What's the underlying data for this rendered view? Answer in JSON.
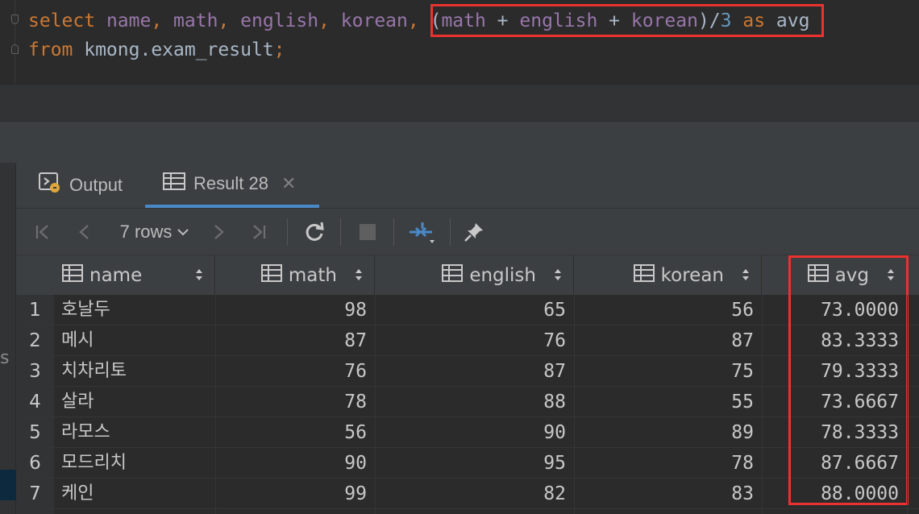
{
  "editor": {
    "line1": [
      {
        "t": "select",
        "c": "kw"
      },
      {
        "t": " ",
        "c": "plain"
      },
      {
        "t": "name",
        "c": "col"
      },
      {
        "t": ", ",
        "c": "kw"
      },
      {
        "t": "math",
        "c": "col"
      },
      {
        "t": ", ",
        "c": "kw"
      },
      {
        "t": "english",
        "c": "col"
      },
      {
        "t": ", ",
        "c": "kw"
      },
      {
        "t": "korean",
        "c": "col"
      },
      {
        "t": ", ",
        "c": "kw"
      },
      {
        "t": "(",
        "c": "plain"
      },
      {
        "t": "math",
        "c": "col"
      },
      {
        "t": " + ",
        "c": "plain"
      },
      {
        "t": "english",
        "c": "col"
      },
      {
        "t": " + ",
        "c": "plain"
      },
      {
        "t": "korean",
        "c": "col"
      },
      {
        "t": ")/",
        "c": "plain"
      },
      {
        "t": "3",
        "c": "num"
      },
      {
        "t": " as ",
        "c": "kw"
      },
      {
        "t": "avg",
        "c": "plain"
      }
    ],
    "line2": [
      {
        "t": "from",
        "c": "kw"
      },
      {
        "t": " kmong.exam_result",
        "c": "plain"
      },
      {
        "t": ";",
        "c": "kw"
      }
    ]
  },
  "tabs": {
    "output_label": "Output",
    "result_label": "Result 28"
  },
  "toolbar": {
    "rows_label": "7 rows"
  },
  "left_fragment": "s",
  "columns": [
    "name",
    "math",
    "english",
    "korean",
    "avg"
  ],
  "rows": [
    {
      "n": "1",
      "name": "호날두",
      "math": "98",
      "english": "65",
      "korean": "56",
      "avg": "73.0000"
    },
    {
      "n": "2",
      "name": "메시",
      "math": "87",
      "english": "76",
      "korean": "87",
      "avg": "83.3333"
    },
    {
      "n": "3",
      "name": "치차리토",
      "math": "76",
      "english": "87",
      "korean": "75",
      "avg": "79.3333"
    },
    {
      "n": "4",
      "name": "살라",
      "math": "78",
      "english": "88",
      "korean": "55",
      "avg": "73.6667"
    },
    {
      "n": "5",
      "name": "라모스",
      "math": "56",
      "english": "90",
      "korean": "89",
      "avg": "78.3333"
    },
    {
      "n": "6",
      "name": "모드리치",
      "math": "90",
      "english": "95",
      "korean": "78",
      "avg": "87.6667"
    },
    {
      "n": "7",
      "name": "케인",
      "math": "99",
      "english": "82",
      "korean": "83",
      "avg": "88.0000"
    }
  ],
  "colors": {
    "accent": "#4a88c7",
    "highlight": "#e8332f",
    "keyword": "#cc7832",
    "identifier": "#9876aa",
    "number": "#6897bb"
  }
}
